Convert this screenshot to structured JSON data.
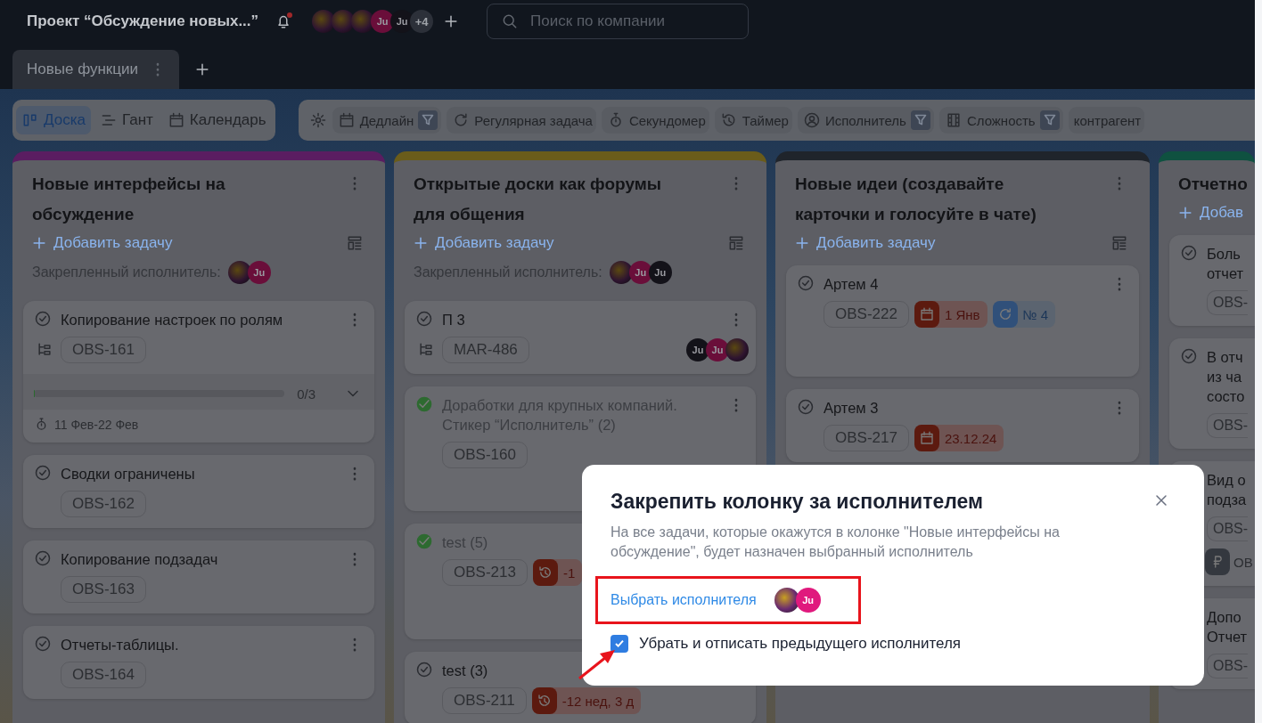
{
  "header": {
    "project_title": "Проект “Обсуждение новых...”",
    "notifications_unread": true,
    "members": [
      {
        "kind": "photo"
      },
      {
        "kind": "photo"
      },
      {
        "kind": "photo"
      },
      {
        "kind": "initials",
        "text": "Ju",
        "color": "#6a0e3a"
      },
      {
        "kind": "initials",
        "text": "Ju",
        "color": "#131219"
      }
    ],
    "more_members": "+4",
    "search": {
      "placeholder": "Поиск по компании"
    }
  },
  "board_tabs": [
    {
      "label": "Новые функции",
      "selected": true
    }
  ],
  "views": [
    {
      "label": "Доска",
      "kind": "board",
      "selected": true
    },
    {
      "label": "Гант",
      "kind": "gantt",
      "selected": false
    },
    {
      "label": "Календарь",
      "kind": "calendar",
      "selected": false
    }
  ],
  "filters": [
    {
      "label": "Дедлайн",
      "kind": "calendar",
      "filtered": true
    },
    {
      "label": "Регулярная задача",
      "kind": "repeat",
      "filtered": false
    },
    {
      "label": "Секундомер",
      "kind": "stopwatch",
      "filtered": false
    },
    {
      "label": "Таймер",
      "kind": "timer",
      "filtered": false
    },
    {
      "label": "Исполнитель",
      "kind": "user",
      "filtered": true
    },
    {
      "label": "Сложность",
      "kind": "film",
      "filtered": true
    },
    {
      "label": "контрагент",
      "kind": "none",
      "filtered": false
    }
  ],
  "columns": [
    {
      "title": "Новые интерфейсы на обсуждение",
      "color": "#5a1d61",
      "add_label": "Добавить задачу",
      "pinned_label": "Закрепленный исполнитель:",
      "pinned": [
        {
          "kind": "photo"
        },
        {
          "kind": "initials",
          "text": "Ju",
          "color": "#6a0e3a"
        }
      ],
      "cards": [
        {
          "title": "Копирование настроек по ролям",
          "done": false,
          "subtasks": true,
          "code": "OBS-161",
          "progress": {
            "level": 0,
            "text": "0/3"
          },
          "period": "11 Фев-22 Фев"
        },
        {
          "title": "Сводки ограничены",
          "done": false,
          "subtasks": false,
          "code": "OBS-162"
        },
        {
          "title": "Копирование подзадач",
          "done": false,
          "subtasks": false,
          "code": "OBS-163"
        },
        {
          "title": "Отчеты-таблицы.",
          "done": false,
          "subtasks": false,
          "code": "OBS-164"
        }
      ]
    },
    {
      "title": "Открытые доски как форумы для общения",
      "color": "#6a5c1a",
      "add_label": "Добавить задачу",
      "pinned_label": "Закрепленный исполнитель:",
      "pinned": [
        {
          "kind": "photo"
        },
        {
          "kind": "initials",
          "text": "Ju",
          "color": "#6a0e3a"
        },
        {
          "kind": "initials",
          "text": "Ju",
          "color": "#131219"
        }
      ],
      "cards": [
        {
          "title": "П 3",
          "done": false,
          "subtasks": true,
          "code": "MAR-486",
          "avatars": [
            {
              "kind": "initials",
              "text": "Ju",
              "color": "#131219"
            },
            {
              "kind": "initials",
              "text": "Ju",
              "color": "#6a0e3a"
            },
            {
              "kind": "photo"
            }
          ]
        },
        {
          "title": "Доработки для крупных компаний. Стикер “Исполнитель” (2)",
          "done": true,
          "subtasks": false,
          "code": "OBS-160"
        },
        {
          "title": "test (5)",
          "done": true,
          "subtasks": false,
          "code": "OBS-213",
          "tags": [
            {
              "kind": "overdue",
              "text": "-1"
            }
          ]
        },
        {
          "title": "test (3)",
          "done": false,
          "subtasks": false,
          "code": "OBS-211",
          "tags": [
            {
              "kind": "overdue",
              "text": "-12 нед, 3 д"
            }
          ]
        }
      ]
    },
    {
      "title": "Новые идеи (создавайте карточки и голосуйте в чате)",
      "color": "#1f242b",
      "add_label": "Добавить задачу",
      "cards": [
        {
          "title": "Артем 4",
          "done": false,
          "subtasks": false,
          "code": "OBS-222",
          "tags": [
            {
              "kind": "deadline",
              "text": "1 Янв"
            },
            {
              "kind": "repeat",
              "text": "№ 4"
            }
          ]
        },
        {
          "title": "Артем 3",
          "done": false,
          "subtasks": false,
          "code": "OBS-217",
          "tags": [
            {
              "kind": "deadline",
              "text": "23.12.24"
            }
          ]
        }
      ]
    },
    {
      "title": "Отчетно",
      "color": "#0f5140",
      "add_label": "Добав",
      "cards": [
        {
          "title": "Боль отчет",
          "done": false,
          "subtasks": false,
          "code": "OBS-"
        },
        {
          "title": "В отч из ча состо",
          "done": false,
          "subtasks": false,
          "code": "OBS-"
        },
        {
          "title": "Вид о подза",
          "subtasks": false,
          "code": "OBS-",
          "tags": [
            {
              "kind": "ruble",
              "text": "OB"
            }
          ]
        },
        {
          "title": "Допо Отчет",
          "subtasks": false,
          "code": "OBS-"
        }
      ]
    }
  ],
  "modal": {
    "title": "Закрепить колонку за исполнителем",
    "description": "На все задачи, которые окажутся в колонке \"Новые интерфейсы на обсуждение\", будет назначен выбранный исполнитель",
    "choose_link": "Выбрать исполнителя",
    "assignees": [
      {
        "kind": "photo"
      },
      {
        "kind": "initials",
        "text": "Ju",
        "color": "#e0197d"
      }
    ],
    "checkbox": {
      "label": "Убрать и отписать предыдущего исполнителя",
      "checked": true
    }
  }
}
